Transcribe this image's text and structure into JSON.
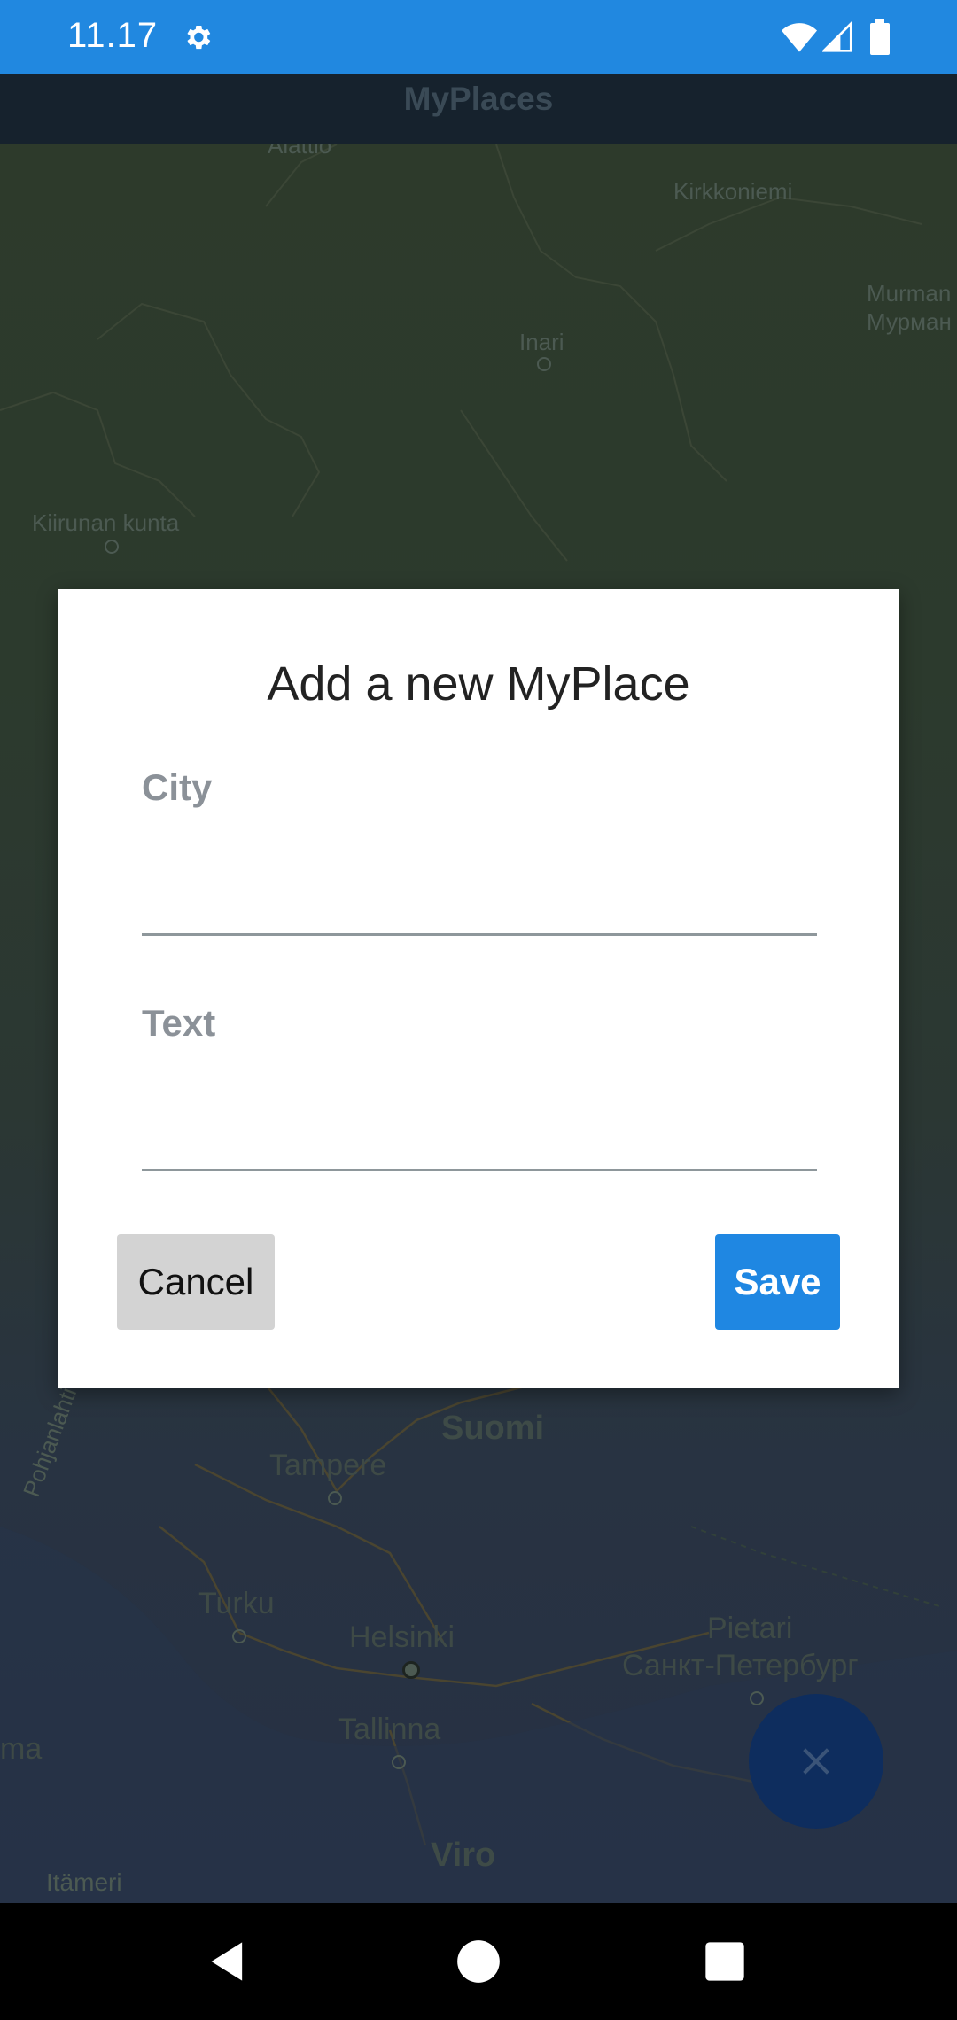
{
  "status_bar": {
    "time": "11.17",
    "icons": [
      "settings-icon",
      "wifi-icon",
      "signal-icon",
      "battery-icon"
    ]
  },
  "app_bar": {
    "title": "MyPlaces"
  },
  "map": {
    "labels": [
      {
        "text": "Alattio"
      },
      {
        "text": "Kirkkoniemi"
      },
      {
        "text": "Murman\nМурман"
      },
      {
        "text": "Inari"
      },
      {
        "text": "Kiirunan kunta"
      },
      {
        "text": "Pohjanlahti"
      },
      {
        "text": "Suomi"
      },
      {
        "text": "Tampere"
      },
      {
        "text": "Turku"
      },
      {
        "text": "Helsinki"
      },
      {
        "text": "Pietari"
      },
      {
        "text": "Санкт-Петербург"
      },
      {
        "text": "Tallinna"
      },
      {
        "text": "ma"
      },
      {
        "text": "Viro"
      },
      {
        "text": "Itämeri"
      }
    ]
  },
  "dialog": {
    "title": "Add a new MyPlace",
    "city_label": "City",
    "city_value": "",
    "text_label": "Text",
    "text_value": "",
    "cancel_label": "Cancel",
    "save_label": "Save"
  },
  "fab": {
    "icon": "close-icon"
  },
  "nav_bar": {
    "icons": [
      "back-icon",
      "home-icon",
      "recents-icon"
    ]
  },
  "colors": {
    "status_bar": "#2188e0",
    "accent": "#1f87e2",
    "cancel_bg": "#d3d3d3",
    "fab_bg": "#0e2d5e"
  }
}
